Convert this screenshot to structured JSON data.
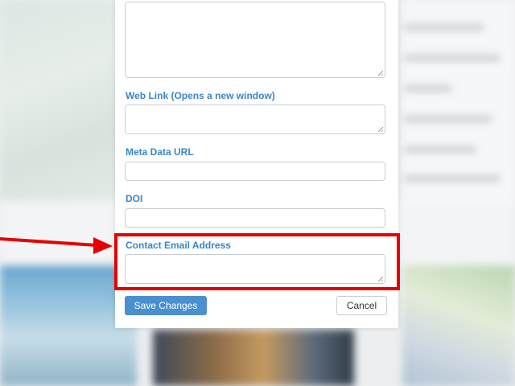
{
  "form": {
    "fields": {
      "web_link": {
        "label": "Web Link (Opens a new window)",
        "value": ""
      },
      "meta_data_url": {
        "label": "Meta Data URL",
        "value": ""
      },
      "doi": {
        "label": "DOI",
        "value": ""
      },
      "contact_email": {
        "label": "Contact Email Address",
        "value": ""
      }
    },
    "buttons": {
      "save_label": "Save Changes",
      "cancel_label": "Cancel"
    }
  },
  "colors": {
    "label_blue": "#3a86c8",
    "primary_button": "#4a8fd0",
    "annotation_red": "#e60000"
  },
  "icons": {
    "resize": "resize-grip-icon",
    "annotation_arrow": "arrow-right-icon"
  }
}
